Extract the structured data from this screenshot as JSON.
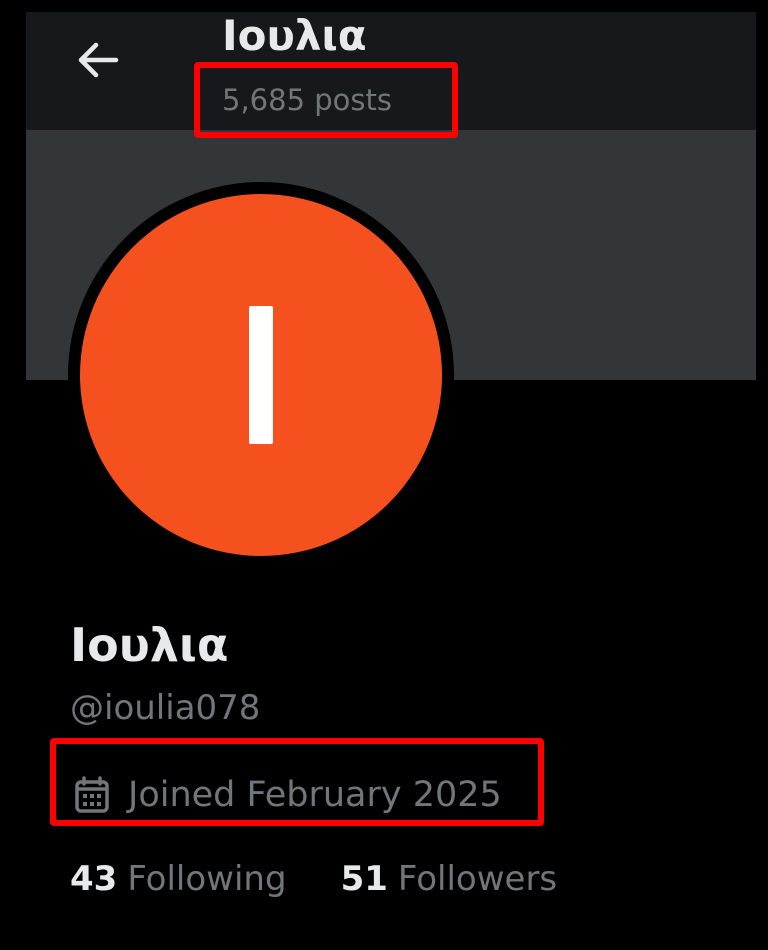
{
  "header": {
    "title": "Ιουλια",
    "posts_count": "5,685 posts",
    "back_icon": "arrow-left-icon"
  },
  "profile": {
    "avatar_letter": "I",
    "avatar_color": "#f4511e",
    "display_name": "Ιουλια",
    "handle": "@ioulia078",
    "joined": "Joined February 2025",
    "joined_icon": "calendar-icon"
  },
  "stats": {
    "following_count": "43",
    "following_label": "Following",
    "followers_count": "51",
    "followers_label": "Followers"
  },
  "annotations": {
    "highlight_color": "#ff0000"
  }
}
